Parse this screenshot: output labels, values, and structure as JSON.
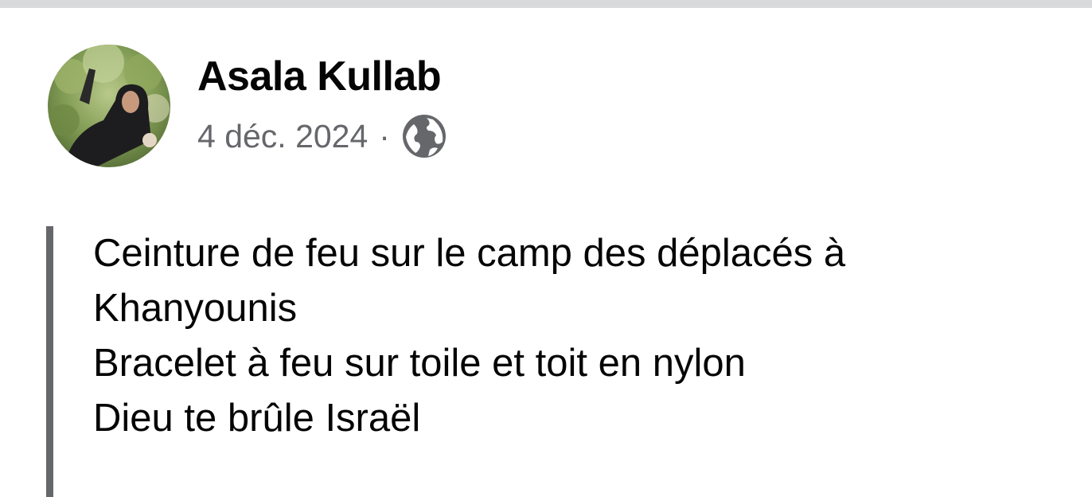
{
  "post": {
    "author": "Asala Kullab",
    "date": "4 déc. 2024",
    "separator": "·",
    "privacy_icon": "globe-icon",
    "quote_lines": [
      "Ceinture de feu sur le camp des déplacés à",
      "Khanyounis",
      "Bracelet à feu sur toile et toit en nylon",
      "Dieu te brûle Israël"
    ]
  },
  "colors": {
    "top_bar": "#d9dadc",
    "name_text": "#050505",
    "meta_text": "#65676b",
    "quote_bar": "#65676b"
  }
}
